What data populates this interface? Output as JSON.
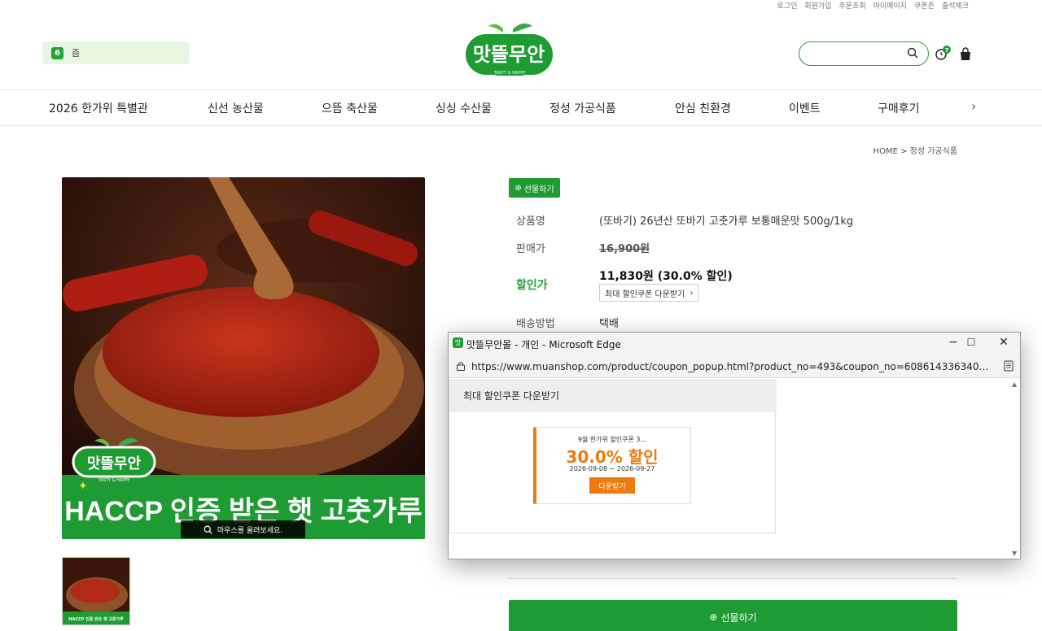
{
  "top_links": [
    "로그인",
    "회원가입",
    "주문조회",
    "마이페이지",
    "쿠폰존",
    "출석체크"
  ],
  "today": {
    "badge": "6",
    "label": "즘"
  },
  "logo": {
    "text": "맛뜰무안",
    "sub": "TASTY & HAPPY"
  },
  "header": {
    "recent_count": "7"
  },
  "nav": {
    "items": [
      "2026 한가위 특별관",
      "신선 농산물",
      "으뜸 축산물",
      "싱싱 수산물",
      "정성 가공식품",
      "안심 친환경",
      "이벤트",
      "구매후기"
    ],
    "more": "›"
  },
  "breadcrumb": "HOME > 정성 가공식품",
  "image": {
    "logo_text": "맛뜰무안",
    "logo_sub": "TASTY & HAPPY",
    "banner": "HACCP 인증 받은 햇 고춧가루",
    "mouseover": "마우스를 올려보세요.",
    "thumb_banner": "HACCP 인증 받은 햇 고춧가루"
  },
  "product": {
    "gift_small": "선물하기",
    "name_label": "상품명",
    "name": "(또바기) 26년산 또바기 고춧가루 보통매운맛 500g/1kg",
    "price_label": "판매가",
    "price": "16,900원",
    "sale_label": "할인가",
    "sale": "11,830원 (30.0% 할인)",
    "coupon_download": "최대 할인쿠폰 다운받기",
    "shipping_label": "배송방법",
    "shipping": "택배",
    "gift_big": "선물하기"
  },
  "popup": {
    "title": "맛뜰무안몰 - 개인 - Microsoft Edge",
    "url": "https://www.muanshop.com/product/coupon_popup.html?product_no=493&coupon_no=6086143363400000629...",
    "heading": "최대 할인쿠폰 다운받기",
    "coupon": {
      "title": "9월 한가위 할인쿠폰 3...",
      "discount": "30.0% 할인",
      "period": "2026-09-08 ~ 2026-09-27",
      "button": "다운받기"
    },
    "min": "−",
    "max": "☐",
    "close": "✕"
  },
  "colors": {
    "brand_green": "#1f9b34",
    "coupon_orange": "#ef7a10",
    "chili_red": "#b5301c"
  }
}
